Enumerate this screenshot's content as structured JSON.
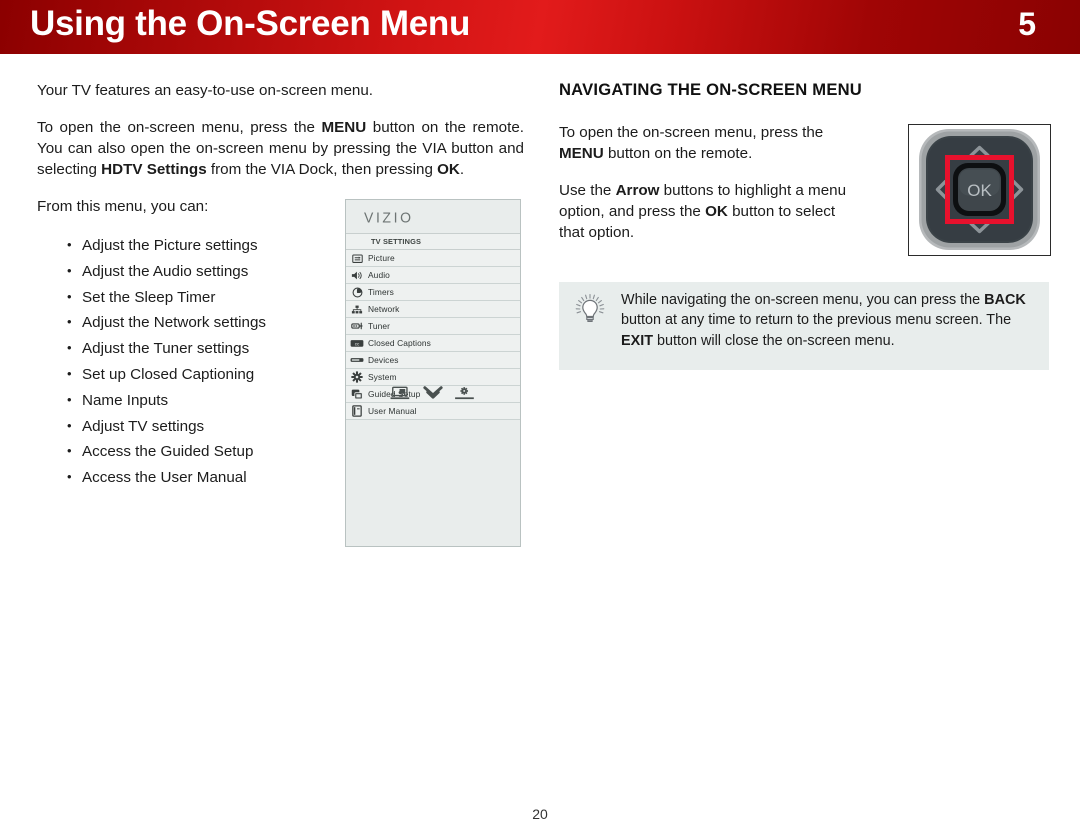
{
  "header": {
    "title": "Using the On-Screen Menu",
    "chapter": "5",
    "accent_color": "#c81111"
  },
  "left_column": {
    "intro": "Your TV features an easy-to-use on-screen menu.",
    "para2": {
      "t1": "To open the on-screen menu, press the ",
      "b1": "MENU",
      "t2": " button on the remote. You can also open the on-screen menu by pressing the VIA button and selecting ",
      "b2": "HDTV Settings",
      "t3": " from the VIA Dock, then pressing ",
      "b3": "OK",
      "t4": "."
    },
    "list_lead": "From this menu, you can:",
    "bullets": [
      "Adjust the Picture settings",
      "Adjust the Audio settings",
      "Set the Sleep Timer",
      "Adjust the Network settings",
      "Adjust the Tuner settings",
      "Set up Closed Captioning",
      "Name Inputs",
      "Adjust TV settings",
      "Access the Guided Setup",
      "Access the User Manual"
    ]
  },
  "tv_menu": {
    "brand": "VIZIO",
    "section_label": "TV SETTINGS",
    "items": [
      {
        "label": "Picture",
        "icon": "picture-icon"
      },
      {
        "label": "Audio",
        "icon": "speaker-icon"
      },
      {
        "label": "Timers",
        "icon": "clock-icon"
      },
      {
        "label": "Network",
        "icon": "network-icon"
      },
      {
        "label": "Tuner",
        "icon": "tuner-icon"
      },
      {
        "label": "Closed Captions",
        "icon": "closed-captions-icon"
      },
      {
        "label": "Devices",
        "icon": "devices-icon"
      },
      {
        "label": "System",
        "icon": "gear-icon"
      },
      {
        "label": "Guided Setup",
        "icon": "guided-setup-icon"
      },
      {
        "label": "User Manual",
        "icon": "user-manual-icon"
      }
    ],
    "footer_icons": [
      "wide-screen-icon",
      "chevron-double-down-icon",
      "settings-gear-icon"
    ]
  },
  "right_column": {
    "heading": "NAVIGATING THE ON-SCREEN MENU",
    "para1": {
      "t1": "To open the on-screen menu, press the ",
      "b1": "MENU",
      "t2": " button on the remote."
    },
    "para2": {
      "t1": "Use the ",
      "b1": "Arrow",
      "t2": " buttons to highlight a menu option, and press the ",
      "b2": "OK",
      "t3": " button to select that option."
    }
  },
  "remote": {
    "ok_label": "OK",
    "highlight_color": "#e8112d",
    "body_color": "#3a4247",
    "bezel_color": "#a7aaac"
  },
  "tip_box": {
    "icon": "lightbulb-icon",
    "t1": "While navigating the on-screen menu, you can press the ",
    "b1": "BACK",
    "t2": " button at any time to return to the previous menu screen. The ",
    "b2": "EXIT",
    "t3": " button will close the on-screen menu."
  },
  "footer": {
    "page_number": "20"
  }
}
